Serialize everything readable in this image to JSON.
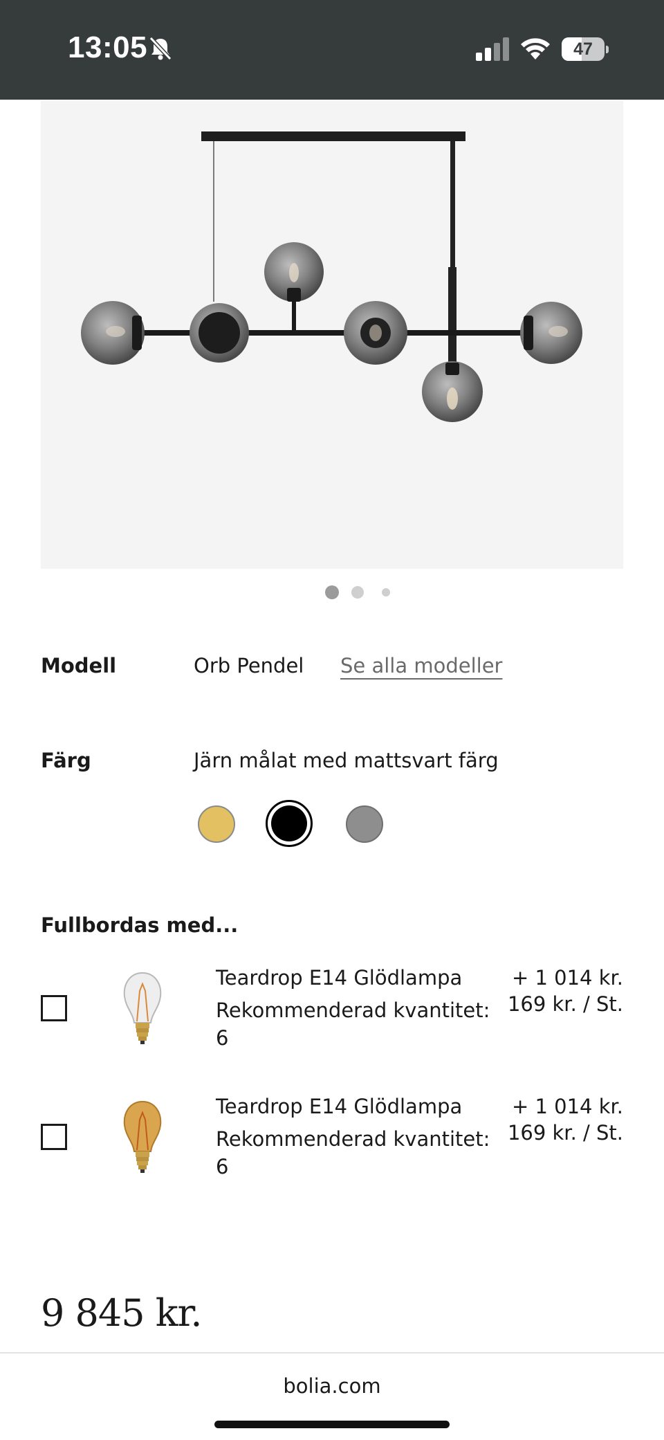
{
  "status_bar": {
    "time": "13:05",
    "battery_level": "47",
    "battery_fraction": 0.47,
    "icons": [
      "bell-slash-icon",
      "signal-icon",
      "wifi-icon",
      "battery-icon"
    ]
  },
  "product": {
    "image_icon": "pendant-lamp-image",
    "carousel": {
      "count": 3,
      "active_index": 0
    }
  },
  "model": {
    "label": "Modell",
    "value": "Orb Pendel",
    "link": "Se alla modeller"
  },
  "color": {
    "label": "Färg",
    "value": "Järn målat med mattsvart färg",
    "swatches": [
      {
        "name": "gold",
        "hex": "#e3c062",
        "selected": false
      },
      {
        "name": "black",
        "hex": "#000000",
        "selected": true
      },
      {
        "name": "grey",
        "hex": "#8e8e8e",
        "selected": false
      }
    ]
  },
  "accessories": {
    "title": "Fullbordas med...",
    "items": [
      {
        "name": "Teardrop E14 Glödlampa",
        "recommended": "Rekommenderad kvantitet: 6",
        "total_price": "+ 1 014 kr.",
        "unit_price": "169 kr. / St.",
        "bulb_icon": "clear-bulb-icon",
        "checked": false
      },
      {
        "name": "Teardrop E14 Glödlampa",
        "recommended": "Rekommenderad kvantitet: 6",
        "total_price": "+ 1 014 kr.",
        "unit_price": "169 kr. / St.",
        "bulb_icon": "amber-bulb-icon",
        "checked": false
      }
    ]
  },
  "price": {
    "total": "9 845 kr."
  },
  "browser": {
    "url": "bolia.com"
  }
}
